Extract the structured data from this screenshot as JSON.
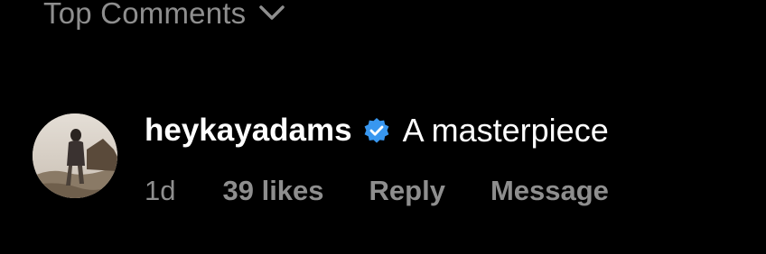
{
  "header": {
    "label": "Top Comments",
    "icon": "chevron-down-icon"
  },
  "comment": {
    "avatar_icon": "avatar",
    "username": "heykayadams",
    "verified_icon": "verified-badge-icon",
    "text": "A masterpiece",
    "time": "1d",
    "likes": "39 likes",
    "reply": "Reply",
    "message": "Message"
  },
  "colors": {
    "background": "#000000",
    "primary_text": "#ffffff",
    "secondary_text": "#8e8e8e",
    "verified_blue": "#3897f0"
  }
}
